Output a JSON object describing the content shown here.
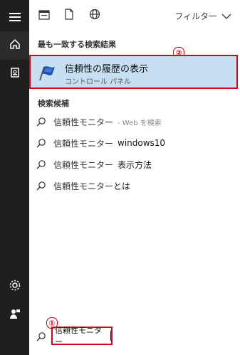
{
  "left_rail": {
    "items": [
      {
        "icon": "hamburger-icon"
      },
      {
        "icon": "home-icon"
      },
      {
        "icon": "document-icon"
      },
      {
        "icon": "settings-icon"
      },
      {
        "icon": "feedback-icon"
      }
    ]
  },
  "topbar": {
    "icons": [
      "apps-filter-icon",
      "documents-filter-icon",
      "web-filter-icon"
    ],
    "filter_label": "フィルター"
  },
  "best_match": {
    "header": "最も一致する検索結果",
    "title": "信頼性の履歴の表示",
    "subtitle": "コントロール パネル",
    "badge": "②"
  },
  "suggestions": {
    "header": "検索候補",
    "query": "信頼性モニター",
    "items": [
      {
        "extra": "",
        "web": "- Web を検索"
      },
      {
        "extra": "windows10",
        "web": ""
      },
      {
        "extra": "表示方法",
        "web": ""
      },
      {
        "extra": "とは",
        "web": ""
      }
    ]
  },
  "search": {
    "value": "信頼性モニター",
    "badge": "①"
  },
  "colors": {
    "rail_bg": "#1f1f1f",
    "highlight_bg": "#c6e0f2",
    "annotation_red": "#d9001b"
  }
}
